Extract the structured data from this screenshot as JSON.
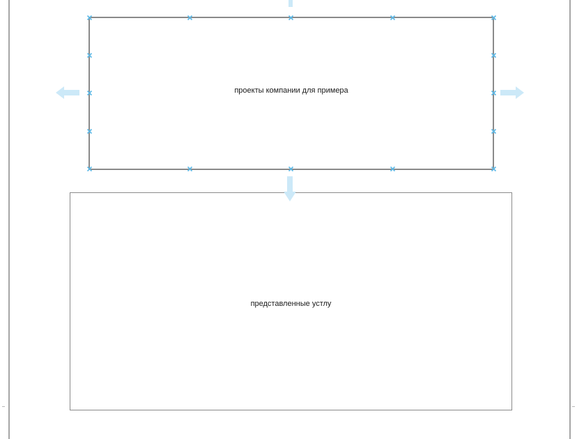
{
  "diagram": {
    "shapes": [
      {
        "id": "top",
        "label": "проекты компании для примера",
        "selected": true
      },
      {
        "id": "bottom",
        "label": "представленные устлу",
        "selected": false
      }
    ]
  },
  "colors": {
    "handle": "#5cb8e6",
    "connect_arrow": "#cce9f8",
    "shape_border": "#8a8a8a",
    "page_border": "#a6a6a6"
  },
  "icons": {
    "handle": "x-mark-icon",
    "arrow": "connection-arrow-icon"
  }
}
